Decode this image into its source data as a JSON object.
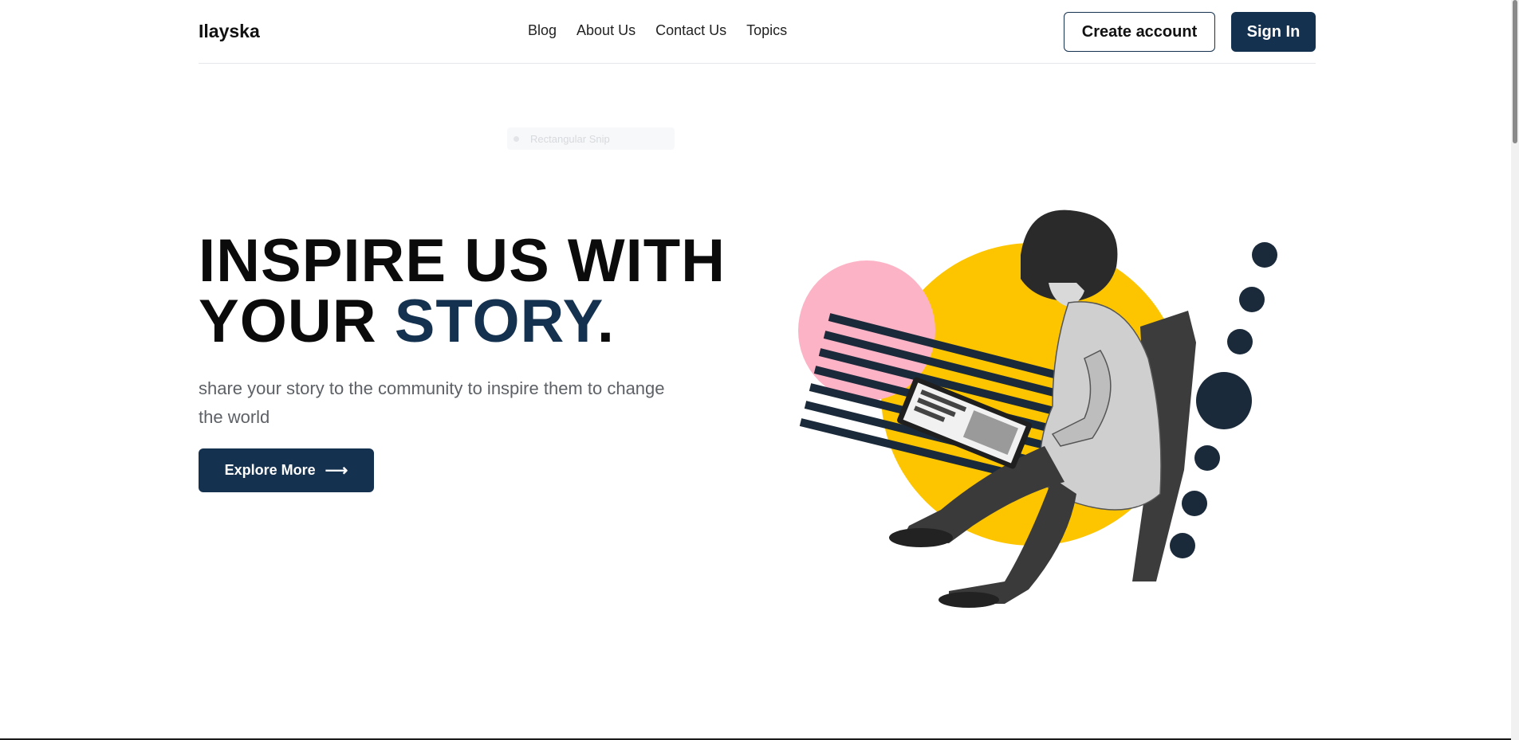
{
  "header": {
    "logo": "Ilayska",
    "nav": [
      "Blog",
      "About Us",
      "Contact Us",
      "Topics"
    ],
    "create_account_label": "Create account",
    "sign_in_label": "Sign In"
  },
  "overlay": {
    "snip_label": "Rectangular Snip"
  },
  "hero": {
    "title_line1": "INSPIRE US WITH",
    "title_line2_prefix": "YOUR ",
    "title_line2_accent": "STORY",
    "title_line2_suffix": ".",
    "subtitle": "share your story to the community to inspire them to change the world",
    "cta_label": "Explore More",
    "cta_icon": "arrow-right-icon"
  },
  "colors": {
    "brand": "#14314f",
    "yellow_blob": "#fcc500",
    "pink_blob": "#fdb3c6",
    "dots": "#1b2a3a"
  }
}
